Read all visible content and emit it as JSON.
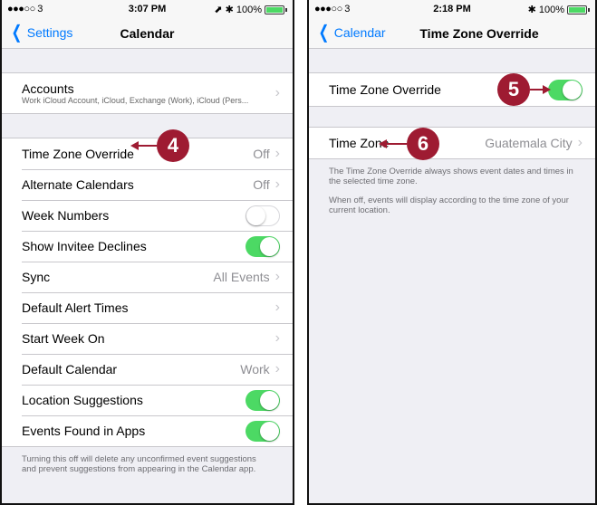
{
  "left": {
    "status": {
      "carrier": "●●●○○ 3",
      "time": "3:07 PM",
      "right": "⬈ ✱ 100%"
    },
    "nav": {
      "back_label": "Settings",
      "title": "Calendar"
    },
    "accounts": {
      "label": "Accounts",
      "sub": "Work iCloud Account, iCloud, Exchange (Work), iCloud (Pers..."
    },
    "rows": [
      {
        "label": "Time Zone Override",
        "value": "Off"
      },
      {
        "label": "Alternate Calendars",
        "value": "Off"
      },
      {
        "label": "Week Numbers",
        "toggle": "off"
      },
      {
        "label": "Show Invitee Declines",
        "toggle": "on"
      },
      {
        "label": "Sync",
        "value": "All Events"
      },
      {
        "label": "Default Alert Times",
        "value": ""
      },
      {
        "label": "Start Week On",
        "value": ""
      },
      {
        "label": "Default Calendar",
        "value": "Work"
      },
      {
        "label": "Location Suggestions",
        "toggle": "on"
      },
      {
        "label": "Events Found in Apps",
        "toggle": "on"
      }
    ],
    "footer": "Turning this off will delete any unconfirmed event suggestions and prevent suggestions from appearing in the Calendar app.",
    "callout": "4"
  },
  "right": {
    "status": {
      "carrier": "●●●○○ 3",
      "time": "2:18 PM",
      "right": "✱ 100%"
    },
    "nav": {
      "back_label": "Calendar",
      "title": "Time Zone Override"
    },
    "override_row": {
      "label": "Time Zone Override",
      "toggle": "on"
    },
    "timezone_row": {
      "label": "Time Zone",
      "value": "Guatemala City"
    },
    "note1": "The Time Zone Override always shows event dates and times in the selected time zone.",
    "note2": "When off, events will display according to the time zone of your current location.",
    "callout5": "5",
    "callout6": "6"
  },
  "colors": {
    "accent": "#007aff",
    "toggle_on": "#4cd964",
    "callout": "#9e1b32"
  }
}
